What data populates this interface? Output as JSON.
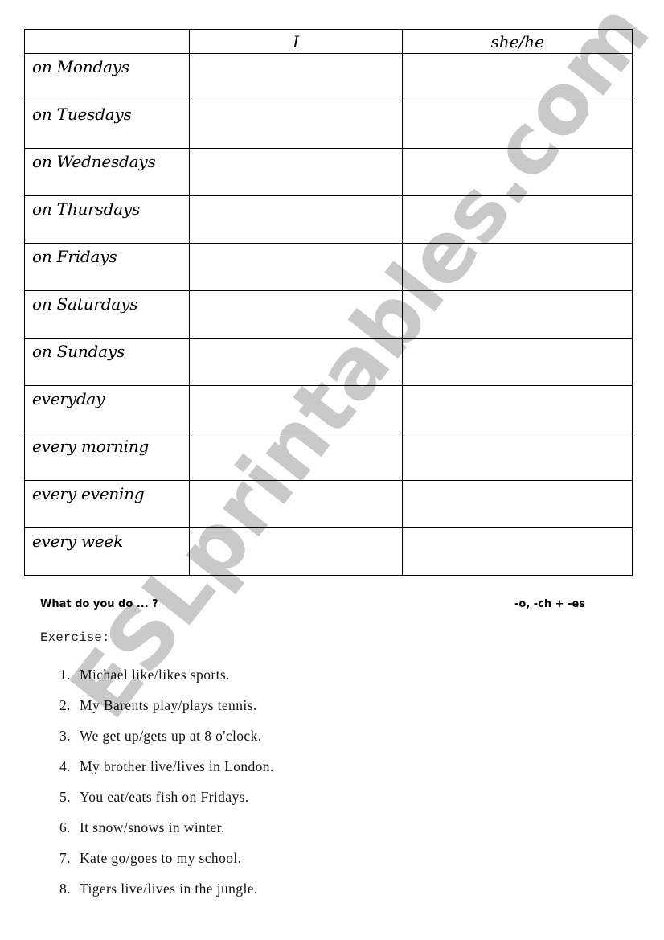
{
  "table": {
    "headers": [
      "",
      "I",
      "she/he"
    ],
    "rows": [
      {
        "label": "on Mondays"
      },
      {
        "label": "on Tuesdays"
      },
      {
        "label": "on Wednesdays"
      },
      {
        "label": "on Thursdays"
      },
      {
        "label": "on Fridays"
      },
      {
        "label": "on Saturdays"
      },
      {
        "label": "on Sundays"
      },
      {
        "label": "everyday"
      },
      {
        "label": "every morning"
      },
      {
        "label": "every evening"
      },
      {
        "label": "every week"
      }
    ]
  },
  "footer": {
    "question": "What do you do ... ?",
    "rule_note": "-o, -ch + -es"
  },
  "exercise": {
    "title": "Exercise:",
    "items": [
      {
        "num": "1.",
        "text": "Michael like/likes sports."
      },
      {
        "num": "2.",
        "text": "My Barents play/plays tennis."
      },
      {
        "num": "3.",
        "text": "We get up/gets up at 8 o'clock."
      },
      {
        "num": "4.",
        "text": "My brother live/lives in London."
      },
      {
        "num": "5.",
        "text": "You eat/eats fish on Fridays."
      },
      {
        "num": "6.",
        "text": "It snow/snows in winter."
      },
      {
        "num": "7.",
        "text": "Kate go/goes to my school."
      },
      {
        "num": "8.",
        "text": "Tigers live/lives in the jungle."
      }
    ]
  },
  "watermark": {
    "text": "ESLprintables.com",
    "color": "#c9c9c9"
  }
}
